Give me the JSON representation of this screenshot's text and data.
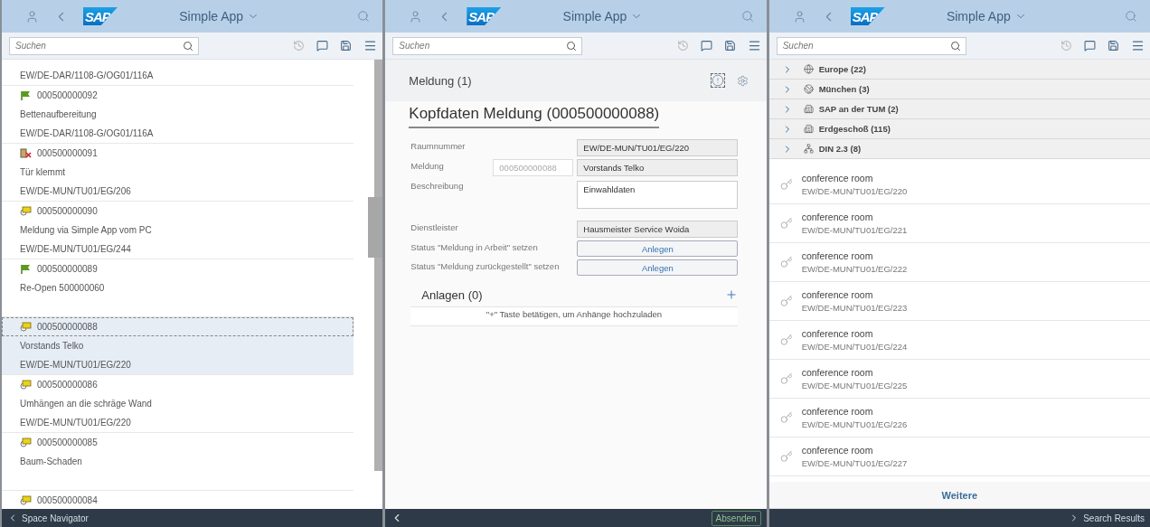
{
  "panels": [
    {
      "header": {
        "logo": "SAP",
        "title": "Simple App"
      },
      "search": {
        "placeholder": "Suchen"
      },
      "notifications": {
        "lead_location": "EW/DE-DAR/1108-G/OG01/116A",
        "items": [
          {
            "number": "000500000092",
            "kind": "flag",
            "description": "Bettenaufbereitung",
            "location": "EW/DE-DAR/1108-G/OG01/116A",
            "selected": false
          },
          {
            "number": "000500000091",
            "kind": "broken",
            "description": "Tür klemmt",
            "location": "EW/DE-MUN/TU01/EG/206",
            "selected": false
          },
          {
            "number": "000500000090",
            "kind": "message",
            "description": "Meldung via Simple App vom PC",
            "location": "EW/DE-MUN/TU01/EG/244",
            "selected": false
          },
          {
            "number": "000500000089",
            "kind": "flag",
            "description": "Re-Open 500000060",
            "selected": false
          },
          {
            "number": "000500000088",
            "kind": "message",
            "description": "Vorstands Telko",
            "location": "EW/DE-MUN/TU01/EG/220",
            "selected": true
          },
          {
            "number": "000500000086",
            "kind": "message",
            "description": "Umhängen an die schräge Wand",
            "location": "EW/DE-MUN/TU01/EG/220",
            "selected": false
          },
          {
            "number": "000500000085",
            "kind": "message",
            "description": "Baum-Schaden",
            "selected": false
          },
          {
            "number": "000500000084",
            "kind": "message",
            "selected": false
          }
        ]
      },
      "footer": {
        "back_label": "Space Navigator"
      }
    },
    {
      "header": {
        "logo": "SAP",
        "title": "Simple App"
      },
      "search": {
        "placeholder": "Suchen"
      },
      "detail": {
        "section_title": "Meldung (1)",
        "title": "Kopfdaten Meldung (000500000088)",
        "fields": [
          {
            "kind": "text",
            "label": "Raumnummer",
            "value": "EW/DE-MUN/TU01/EG/220"
          },
          {
            "kind": "text",
            "label": "Meldung",
            "id": "000500000088",
            "value": "Vorstands Telko"
          },
          {
            "kind": "textarea",
            "label": "Beschreibung",
            "value": "Einwahldaten"
          },
          {
            "kind": "text",
            "label": "Dienstleister",
            "value": "Hausmeister Service Woida"
          },
          {
            "kind": "button",
            "label": "Status \"Meldung in Arbeit\" setzen",
            "value": "Anlegen"
          },
          {
            "kind": "button",
            "label": "Status \"Meldung zurückgestellt\" setzen",
            "value": "Anlegen"
          }
        ],
        "attachments": {
          "title": "Anlagen (0)",
          "hint": "\"+\" Taste betätigen, um Anhänge hochzuladen"
        }
      },
      "footer": {
        "action": "Absenden"
      }
    },
    {
      "header": {
        "logo": "SAP",
        "title": "Simple App"
      },
      "search": {
        "placeholder": "Suchen"
      },
      "tree": [
        {
          "label": "Europe (22)",
          "kind": "region"
        },
        {
          "label": "München (3)",
          "kind": "city"
        },
        {
          "label": "SAP an der TUM (2)",
          "kind": "building"
        },
        {
          "label": "Erdgeschoß (115)",
          "kind": "building"
        },
        {
          "label": "DIN 2.3 (8)",
          "kind": "category"
        }
      ],
      "rooms": [
        {
          "name": "conference room",
          "location": "EW/DE-MUN/TU01/EG/220"
        },
        {
          "name": "conference room",
          "location": "EW/DE-MUN/TU01/EG/221"
        },
        {
          "name": "conference room",
          "location": "EW/DE-MUN/TU01/EG/222"
        },
        {
          "name": "conference room",
          "location": "EW/DE-MUN/TU01/EG/223"
        },
        {
          "name": "conference room",
          "location": "EW/DE-MUN/TU01/EG/224"
        },
        {
          "name": "conference room",
          "location": "EW/DE-MUN/TU01/EG/225"
        },
        {
          "name": "conference room",
          "location": "EW/DE-MUN/TU01/EG/226"
        },
        {
          "name": "conference room",
          "location": "EW/DE-MUN/TU01/EG/227"
        }
      ],
      "more_button": "Weitere",
      "footer": {
        "forward_label": "Search Results"
      }
    }
  ]
}
